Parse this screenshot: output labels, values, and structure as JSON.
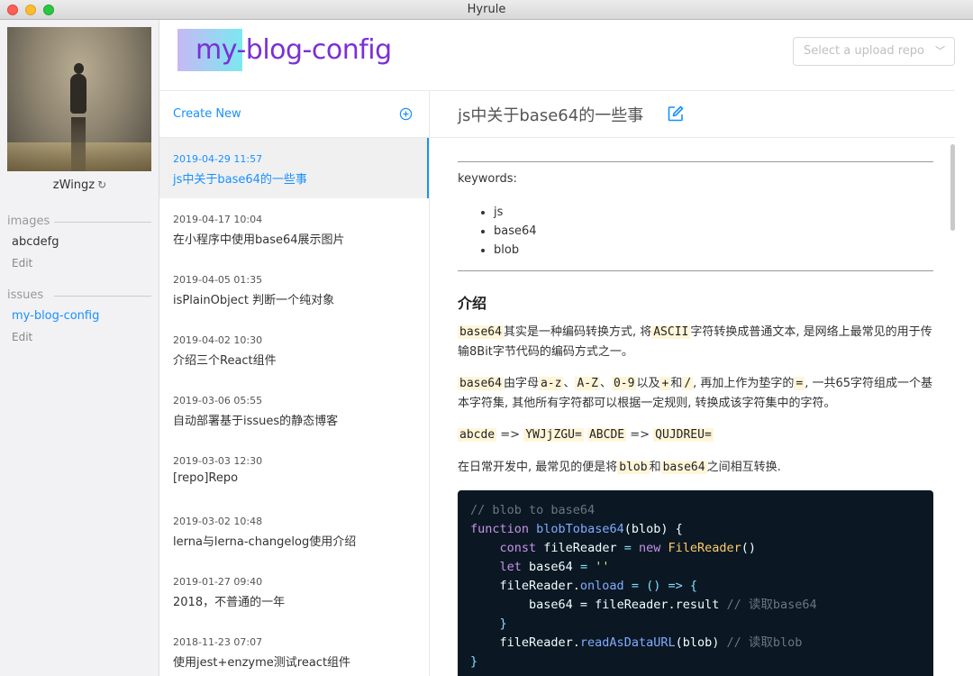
{
  "window": {
    "title": "Hyrule"
  },
  "user": {
    "name": "zWingz",
    "refresh_icon": "↻"
  },
  "sidebar": {
    "images": {
      "label": "images",
      "items": [
        {
          "label": "abcdefg",
          "edit": "Edit"
        }
      ]
    },
    "issues": {
      "label": "issues",
      "items": [
        {
          "label": "my-blog-config",
          "edit": "Edit"
        }
      ]
    }
  },
  "header": {
    "repo_title": "my-blog-config",
    "select_placeholder": "Select a upload repo",
    "select_chevron": "﹀"
  },
  "postlist": {
    "create_label": "Create New",
    "posts": [
      {
        "date": "2019-04-29 11:57",
        "title": "js中关于base64的一些事"
      },
      {
        "date": "2019-04-17 10:04",
        "title": "在小程序中使用base64展示图片"
      },
      {
        "date": "2019-04-05 01:35",
        "title": "isPlainObject 判断一个纯对象"
      },
      {
        "date": "2019-04-02 10:30",
        "title": "介绍三个React组件"
      },
      {
        "date": "2019-03-06 05:55",
        "title": "自动部署基于issues的静态博客"
      },
      {
        "date": "2019-03-03 12:30",
        "title": "[repo]Repo"
      },
      {
        "date": "2019-03-02 10:48",
        "title": "lerna与lerna-changelog使用介绍"
      },
      {
        "date": "2019-01-27 09:40",
        "title": "2018，不普通的一年"
      },
      {
        "date": "2018-11-23 07:07",
        "title": "使用jest+enzyme测试react组件"
      }
    ]
  },
  "article": {
    "title": "js中关于base64的一些事",
    "keywords_label": "keywords:",
    "keywords": [
      "js",
      "base64",
      "blob"
    ],
    "heading": "介绍",
    "p1": {
      "c1": "base64",
      "t1": "其实是一种编码转换方式, 将",
      "c2": "ASCII",
      "t2": "字符转换成普通文本, 是网络上最常见的用于传输8Bit字节代码的编码方式之一。"
    },
    "p2": {
      "c1": "base64",
      "t1": "由字母",
      "c2": "a-z",
      "t2": "、",
      "c3": "A-Z",
      "t3": "、",
      "c4": "0-9",
      "t4": "以及",
      "c5": "+",
      "t5": "和",
      "c6": "/",
      "t6": ", 再加上作为垫字的",
      "c7": "=",
      "t7": ", 一共65字符组成一个基本字符集, 其他所有字符都可以根据一定规则, 转换成该字符集中的字符。"
    },
    "p3": {
      "c1": "abcde",
      "t1": " => ",
      "c2": "YWJjZGU=",
      "t2": " ",
      "c3": "ABCDE",
      "t3": " => ",
      "c4": "QUJDREU="
    },
    "p4": {
      "t1": "在日常开发中, 最常见的便是将",
      "c1": "blob",
      "t2": "和",
      "c2": "base64",
      "t3": "之间相互转换."
    },
    "code": {
      "l1": "// blob to base64",
      "l2_kw": "function",
      "l2_fn": "blobTobase64",
      "l2_rest": "(blob) {",
      "l3_kw": "const",
      "l3_var": "fileReader",
      "l3_eq": " = ",
      "l3_new": "new",
      "l3_cls": "FileReader",
      "l3_end": "()",
      "l4_kw": "let",
      "l4_var": "base64",
      "l4_eq": " = ",
      "l4_str": "''",
      "l5_obj": "fileReader.",
      "l5_fn": "onload",
      "l5_rest": " = () => {",
      "l6_a": "base64 = fileReader.result ",
      "l6_com": "// 读取base64",
      "l7": "}",
      "l8_obj": "fileReader.",
      "l8_fn": "readAsDataURL",
      "l8_arg": "(blob) ",
      "l8_com": "// 读取blob",
      "l9": "}"
    }
  }
}
